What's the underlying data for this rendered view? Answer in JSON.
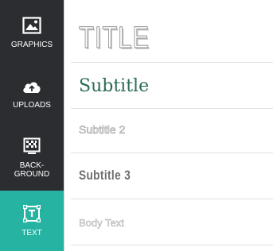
{
  "sidebar": {
    "items": [
      {
        "label": "GRAPHICS",
        "icon": "image-icon"
      },
      {
        "label": "UPLOADS",
        "icon": "cloud-upload-icon"
      },
      {
        "label": "BACK-\nGROUND",
        "icon": "background-pattern-icon"
      },
      {
        "label": "TEXT",
        "icon": "text-box-icon",
        "active": true
      }
    ],
    "background_color": "#2b2d31",
    "active_color": "#26b3a1"
  },
  "text_panel": {
    "options": [
      {
        "label": "TITLE"
      },
      {
        "label": "Subtitle"
      },
      {
        "label": "Subtitle 2"
      },
      {
        "label": "Subtitle 3"
      },
      {
        "label": "Body Text"
      }
    ]
  }
}
